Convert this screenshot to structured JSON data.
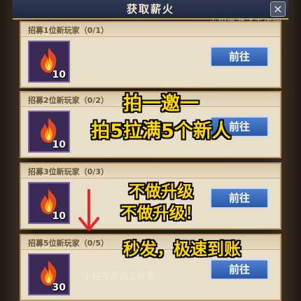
{
  "dialog": {
    "title": "获取薪火",
    "close_icon": "close-icon"
  },
  "watermark": "小程序邀请工作室",
  "watermark_mid": "小程序邀请工作室",
  "cards": [
    {
      "title": "招募1位新玩家（0/1）",
      "qty": "10",
      "button": "前往",
      "icon": "flame-icon"
    },
    {
      "title": "招募2位新玩家（0/2）",
      "qty": "10",
      "button": "前往",
      "icon": "flame-icon"
    },
    {
      "title": "招募3位新玩家（0/3）",
      "qty": "10",
      "button": "前往",
      "icon": "flame-icon"
    },
    {
      "title": "招募5位新玩家（0/5）",
      "qty": "30",
      "button": "前往",
      "icon": "flame-icon"
    }
  ],
  "overlay": {
    "line1": "拍一邀一",
    "line2": "拍5拉满5个新人",
    "line3": "不做升级",
    "line4": "不做升级！",
    "line5": "秒发，极速到账"
  },
  "colors": {
    "overlay_text": "#ffd800",
    "button": "#3b6cc0",
    "arrow": "#e8262a"
  }
}
